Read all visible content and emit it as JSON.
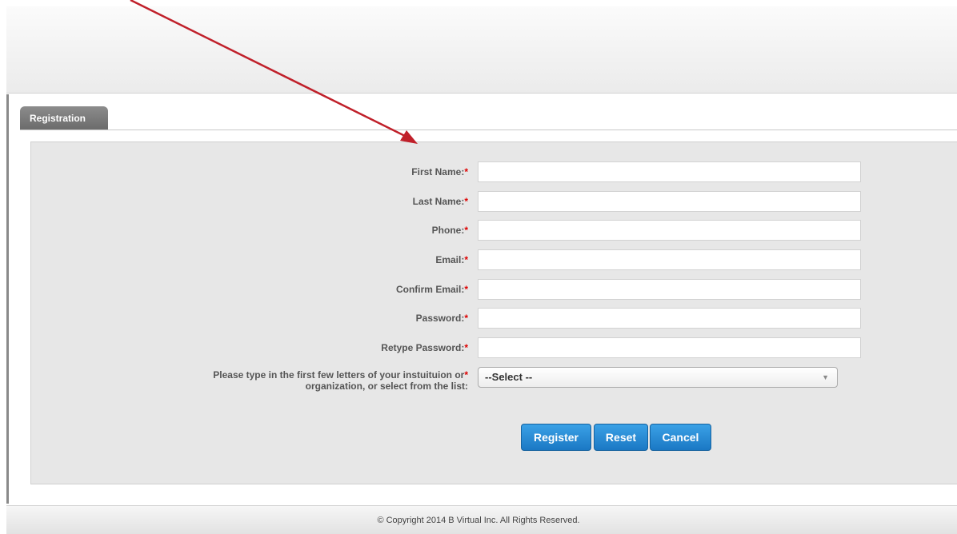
{
  "tab": {
    "label": "Registration"
  },
  "form": {
    "fields": [
      {
        "label": "First Name:",
        "required_mark": "*"
      },
      {
        "label": "Last Name:",
        "required_mark": "*"
      },
      {
        "label": "Phone:",
        "required_mark": "*"
      },
      {
        "label": "Email:",
        "required_mark": "*"
      },
      {
        "label": "Confirm Email:",
        "required_mark": "*"
      },
      {
        "label": "Password:",
        "required_mark": "*"
      },
      {
        "label": "Retype Password:",
        "required_mark": "*"
      }
    ],
    "institution": {
      "label_line1": "Please type in the first few letters of your instuituion or",
      "label_line2": "organization, or select from the list:",
      "required_mark": "*",
      "selected": "--Select --"
    }
  },
  "buttons": {
    "register": "Register",
    "reset": "Reset",
    "cancel": "Cancel"
  },
  "footer": {
    "copyright": "© Copyright 2014 B Virtual Inc. All Rights Reserved."
  },
  "colors": {
    "button_blue": "#1b78c4",
    "required_red": "#dd0000",
    "annotation_arrow": "#c0202a"
  }
}
